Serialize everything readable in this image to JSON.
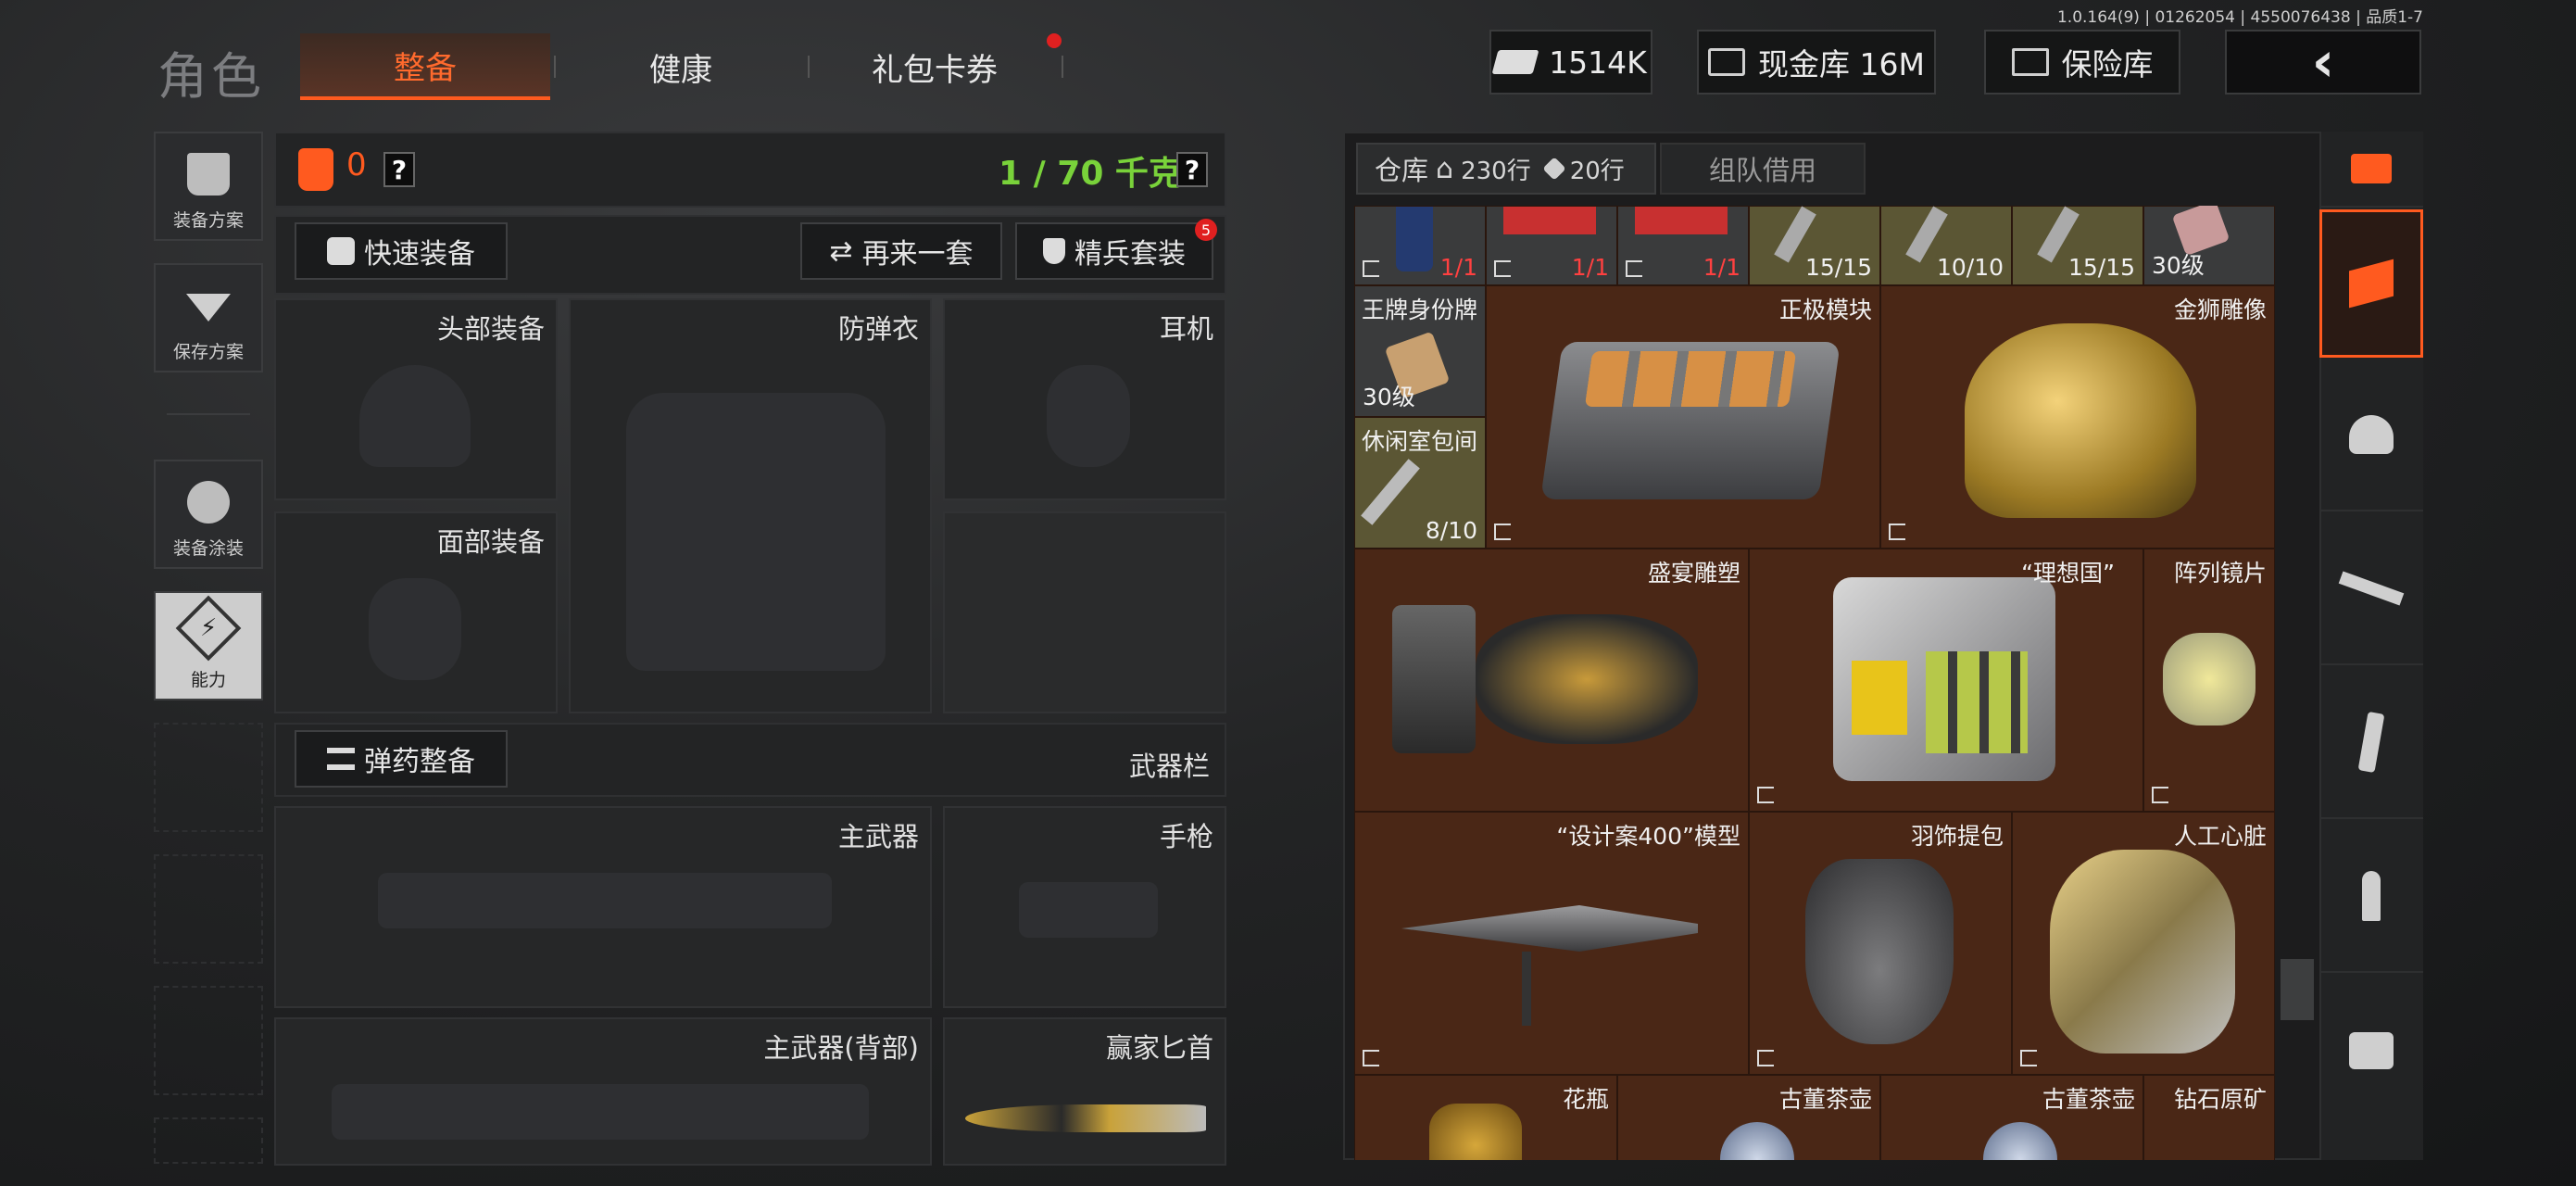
{
  "version_text": "1.0.164(9) | 01262054 | 4550076438 | 品质1-7",
  "header": {
    "title": "角色",
    "tabs": [
      {
        "label": "整备",
        "active": true
      },
      {
        "label": "健康",
        "active": false
      },
      {
        "label": "礼包卡券",
        "active": false
      }
    ],
    "currency": {
      "icon": "cash-icon",
      "value": "1514K"
    },
    "vault_cash": {
      "icon": "cash-box-icon",
      "label": "现金库 16M"
    },
    "safe": {
      "icon": "safe-icon",
      "label": "保险库"
    },
    "back_icon": "chevron-left-icon"
  },
  "side_nav": [
    {
      "label": "装备方案",
      "icon": "vest-icon"
    },
    {
      "label": "保存方案",
      "icon": "download-icon"
    },
    {
      "label": "装备涂装",
      "icon": "soldier-icon"
    },
    {
      "label": "能力",
      "icon": "bolt-icon"
    }
  ],
  "loadout": {
    "armor_count": "0",
    "help": "?",
    "weight": "1 / 70 千克",
    "quick_equip": "快速装备",
    "again": "再来一套",
    "elite": "精兵套装",
    "elite_badge": "5",
    "slots": {
      "head": "头部装备",
      "vest": "防弹衣",
      "ear": "耳机",
      "face": "面部装备"
    },
    "ammo": "弹药整备",
    "weapon_bar": "武器栏",
    "weapons": {
      "primary": "主武器",
      "pistol": "手枪",
      "primary_back": "主武器(背部)",
      "knife": "赢家匕首"
    }
  },
  "warehouse": {
    "tab_label": "仓库",
    "rows_home": "230行",
    "rows_ext": "20行",
    "team_tab": "组队借用",
    "items": [
      {
        "name": "",
        "count": "1/1",
        "red": true
      },
      {
        "name": "",
        "count": "1/1",
        "red": true
      },
      {
        "name": "",
        "count": "1/1",
        "red": true
      },
      {
        "name": "",
        "count": "15/15",
        "red": false
      },
      {
        "name": "",
        "count": "10/10",
        "red": false
      },
      {
        "name": "",
        "count": "15/15",
        "red": false
      },
      {
        "name": "",
        "count": "30级",
        "red": false
      },
      {
        "name": "王牌身份牌",
        "count": "30级",
        "red": false
      },
      {
        "name": "正极模块",
        "count": "",
        "red": false
      },
      {
        "name": "金狮雕像",
        "count": "",
        "red": false
      },
      {
        "name": "休闲室包间",
        "count": "8/10",
        "red": false
      },
      {
        "name": "盛宴雕塑",
        "count": "",
        "red": false
      },
      {
        "name": "“理想国”",
        "count": "",
        "red": false
      },
      {
        "name": "阵列镜片",
        "count": "",
        "red": false
      },
      {
        "name": "“设计案400”模型",
        "count": "",
        "red": false
      },
      {
        "name": "羽饰提包",
        "count": "",
        "red": false
      },
      {
        "name": "人工心脏",
        "count": "",
        "red": false
      },
      {
        "name": "花瓶",
        "count": "",
        "red": false
      },
      {
        "name": "古董茶壶",
        "count": "",
        "red": false
      },
      {
        "name": "古董茶壶",
        "count": "",
        "red": false
      },
      {
        "name": "钻石原矿",
        "count": "",
        "red": false
      }
    ]
  },
  "right_filters": [
    "sort-icon",
    "layers-icon",
    "helmet-icon",
    "rifle-icon",
    "magazine-icon",
    "bullet-icon",
    "scope-icon"
  ],
  "colors": {
    "accent": "#ff5a1f",
    "weight_green": "#79d23a",
    "item_bg": "#4a2716",
    "item_gold_bg": "#5b5634"
  }
}
